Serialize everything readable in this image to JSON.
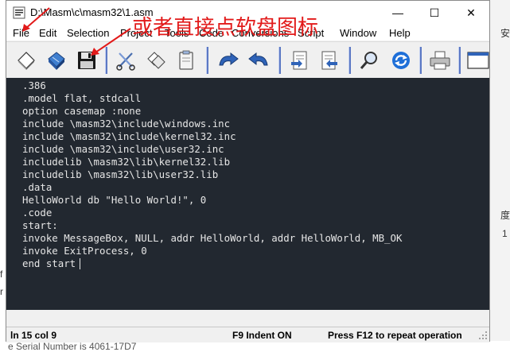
{
  "window": {
    "title": "D:\\Masm\\c\\masm32\\1.asm",
    "controls": {
      "minimize": "—",
      "maximize": "☐",
      "close": "✕"
    }
  },
  "menu": [
    "File",
    "Edit",
    "Selection",
    "Project",
    "Tools",
    "Code",
    "Conversions",
    "Script",
    "Window",
    "Help"
  ],
  "toolbar": {
    "buttons": [
      {
        "name": "new-file",
        "icon": "blank-page-icon"
      },
      {
        "name": "open-file",
        "icon": "open-book-icon"
      },
      {
        "name": "save-file",
        "icon": "floppy-disk-icon"
      },
      {
        "name": "cut",
        "icon": "scissors-icon"
      },
      {
        "name": "copy",
        "icon": "copy-pages-icon"
      },
      {
        "name": "paste",
        "icon": "clipboard-icon"
      },
      {
        "name": "undo",
        "icon": "undo-arrow-icon"
      },
      {
        "name": "redo",
        "icon": "redo-arrow-icon"
      },
      {
        "name": "indent",
        "icon": "indent-right-icon"
      },
      {
        "name": "outdent",
        "icon": "indent-left-icon"
      },
      {
        "name": "find",
        "icon": "magnifier-icon"
      },
      {
        "name": "replace",
        "icon": "refresh-icon"
      },
      {
        "name": "print",
        "icon": "printer-icon"
      },
      {
        "name": "window",
        "icon": "window-icon"
      }
    ]
  },
  "annotation": "或者直接点软盘图标",
  "code": [
    ".386",
    ".model flat, stdcall",
    "option casemap :none",
    "include \\masm32\\include\\windows.inc",
    "include \\masm32\\include\\kernel32.inc",
    "include \\masm32\\include\\user32.inc",
    "includelib \\masm32\\lib\\kernel32.lib",
    "includelib \\masm32\\lib\\user32.lib",
    ".data",
    "HelloWorld db \"Hello World!\", 0",
    ".code",
    "start:",
    "invoke MessageBox, NULL, addr HelloWorld, addr HelloWorld, MB_OK",
    "invoke ExitProcess, 0",
    "end start"
  ],
  "status": {
    "position": "ln 15 col 9",
    "indent": "F9 Indent ON",
    "hint": "Press F12 to repeat operation"
  },
  "background": {
    "fragments": [
      "安",
      "度",
      "1",
      "f",
      "r"
    ],
    "bottom_text": "e Serial Number is 4061-17D7"
  },
  "colors": {
    "editor_bg": "#222830",
    "editor_text": "#e6e6e6",
    "annotation": "#e21a1a",
    "toolbar_separator": "#5b78c4"
  }
}
